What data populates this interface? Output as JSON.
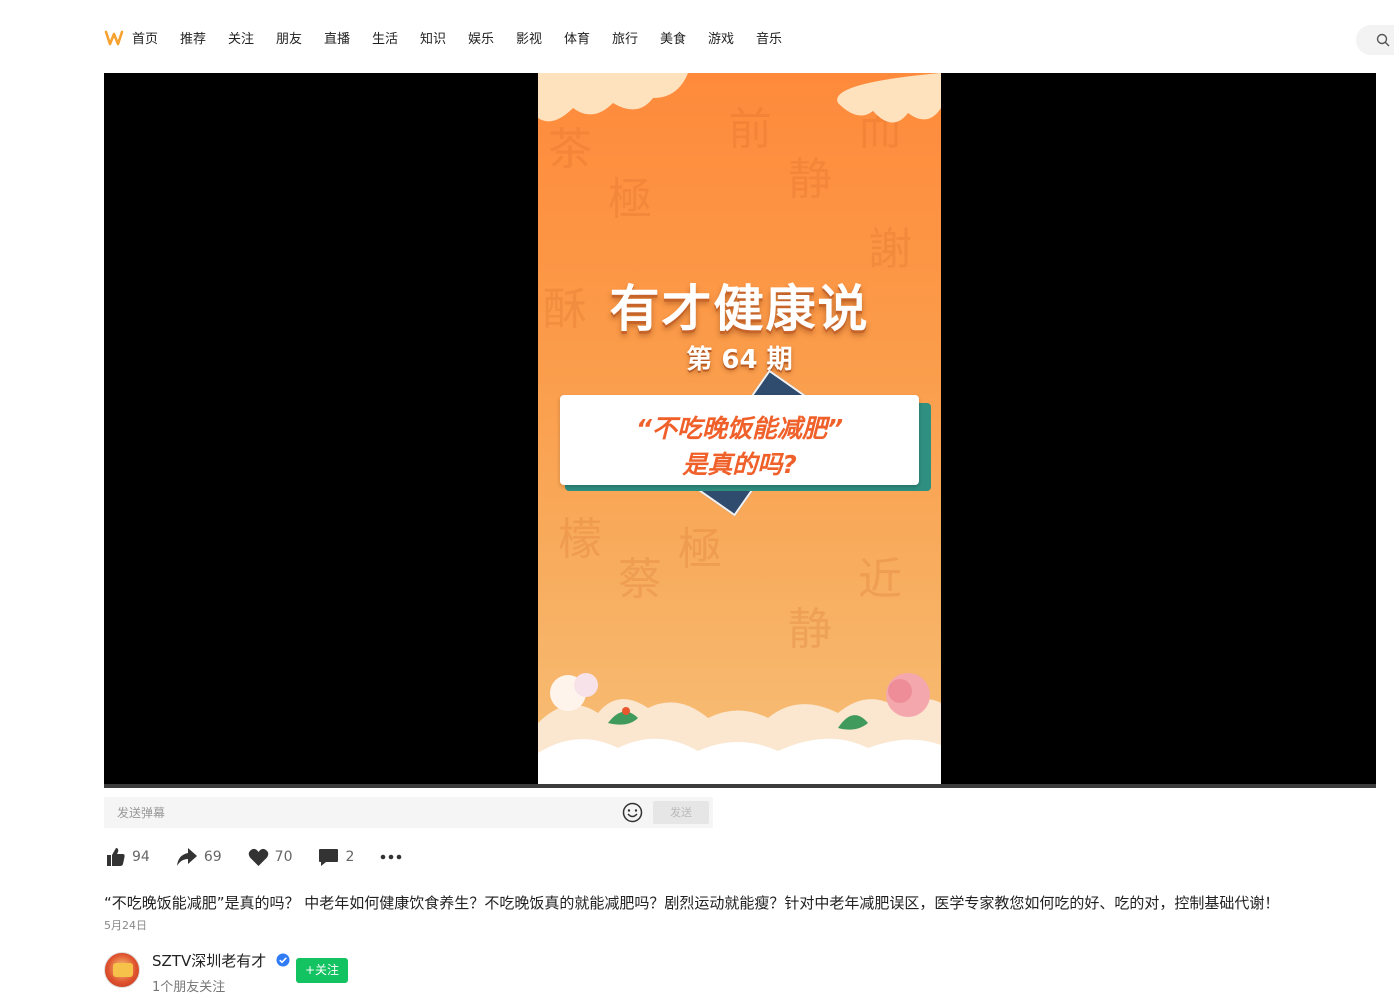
{
  "nav": {
    "items": [
      "首页",
      "推荐",
      "关注",
      "朋友",
      "直播",
      "生活",
      "知识",
      "娱乐",
      "影视",
      "体育",
      "旅行",
      "美食",
      "游戏",
      "音乐"
    ]
  },
  "colors": {
    "brand": "#f7a230",
    "follow_green": "#13c261",
    "verified_blue": "#2f7cf6"
  },
  "video": {
    "poster_title": "有才健康说",
    "poster_issue": "第 64 期",
    "poster_card_line1": "“不吃晚饭能减肥”",
    "poster_card_line2": "是真的吗?"
  },
  "danmaku": {
    "placeholder": "发送弹幕",
    "send_label": "发送"
  },
  "actions": {
    "likes": "94",
    "shares": "69",
    "favorites": "70",
    "comments": "2"
  },
  "post": {
    "description": "“不吃晚饭能减肥”是真的吗？ 中老年如何健康饮食养生？不吃晚饭真的就能减肥吗？剧烈运动就能瘦？针对中老年减肥误区，医学专家教您如何吃的好、吃的对，控制基础代谢！",
    "date": "5月24日"
  },
  "author": {
    "name": "SZTV深圳老有才",
    "subtitle": "1个朋友关注",
    "follow_label": "+关注"
  }
}
